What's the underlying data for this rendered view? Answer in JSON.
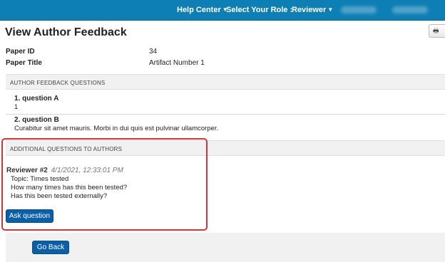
{
  "topnav": {
    "help_center": "Help Center",
    "select_role_label": "Select Your Role :",
    "role_value": "Reviewer"
  },
  "page": {
    "title": "View Author Feedback",
    "print_icon": "print-icon"
  },
  "paper": {
    "id_label": "Paper ID",
    "id_value": "34",
    "title_label": "Paper Title",
    "title_value": "Artifact Number 1"
  },
  "author_feedback": {
    "header": "AUTHOR FEEDBACK QUESTIONS",
    "questions": [
      {
        "title": "1. question A",
        "answer": "1"
      },
      {
        "title": "2. question B",
        "answer": "Curabitur sit amet mauris. Morbi in dui quis est pulvinar ullamcorper."
      }
    ]
  },
  "additional_questions": {
    "header": "ADDITIONAL QUESTIONS TO AUTHORS",
    "reviewer": "Reviewer #2",
    "timestamp": "4/1/2021, 12:33:01 PM",
    "lines": [
      "Topic: Times tested",
      "How many times has this been tested?",
      "Has this been tested externally?"
    ],
    "ask_button": "Ask question"
  },
  "footer": {
    "go_back": "Go Back"
  },
  "colors": {
    "topbar": "#0e7fb5",
    "button": "#0b5ea8",
    "highlight": "#d3343c"
  }
}
